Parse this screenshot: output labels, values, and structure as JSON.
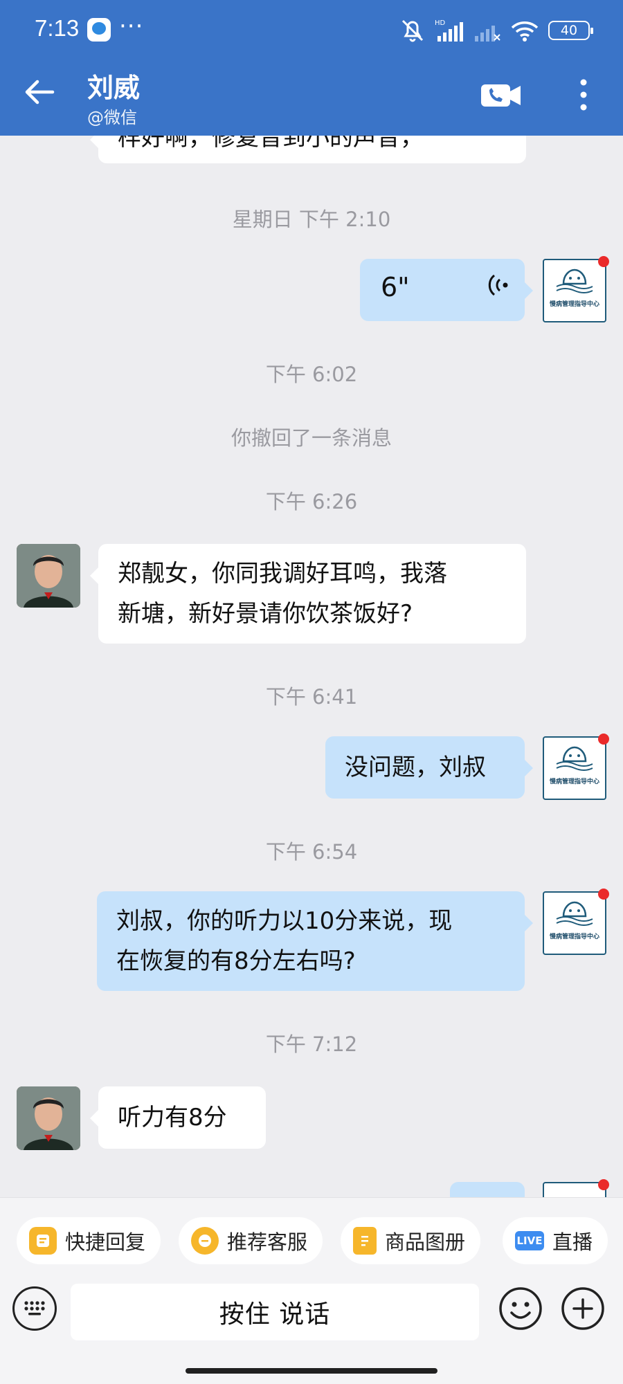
{
  "status_bar": {
    "time": "7:13",
    "more": "···",
    "battery": "40"
  },
  "header": {
    "contact_name": "刘威",
    "subtitle": "@微信"
  },
  "chat": {
    "partial_top_text": "样好啊，修复音到小的声音，",
    "items": [
      {
        "type": "time",
        "text": "星期日  下午 2:10"
      },
      {
        "type": "voice",
        "side": "out",
        "duration": "6\""
      },
      {
        "type": "time",
        "text": "下午 6:02"
      },
      {
        "type": "system",
        "text": "你撤回了一条消息"
      },
      {
        "type": "time",
        "text": "下午 6:26"
      },
      {
        "type": "text",
        "side": "in",
        "text": "郑靓女，你同我调好耳鸣，我落\n新塘，新好景请你饮茶饭好?"
      },
      {
        "type": "time",
        "text": "下午 6:41"
      },
      {
        "type": "text",
        "side": "out",
        "text": "没问题，刘叔"
      },
      {
        "type": "time",
        "text": "下午 6:54"
      },
      {
        "type": "text",
        "side": "out",
        "text": "刘叔，你的听力以10分来说，现\n在恢复的有8分左右吗?"
      },
      {
        "type": "time",
        "text": "下午 7:12"
      },
      {
        "type": "text",
        "side": "in",
        "text": "听力有8分"
      }
    ],
    "logo_caption": "慢病管理指导中心"
  },
  "quick_bar": {
    "chips": [
      {
        "label": "快捷回复",
        "icon": "quick-reply-icon"
      },
      {
        "label": "推荐客服",
        "icon": "recommend-service-icon"
      },
      {
        "label": "商品图册",
        "icon": "product-album-icon"
      },
      {
        "label": "直播",
        "icon": "live-icon",
        "badge": "LIVE"
      }
    ]
  },
  "input_bar": {
    "hold_to_talk": "按住 说话"
  },
  "colors": {
    "header_bg": "#3a74c8",
    "chat_bg": "#ededf0",
    "out_bubble": "#c6e2fb",
    "in_bubble": "#ffffff"
  }
}
